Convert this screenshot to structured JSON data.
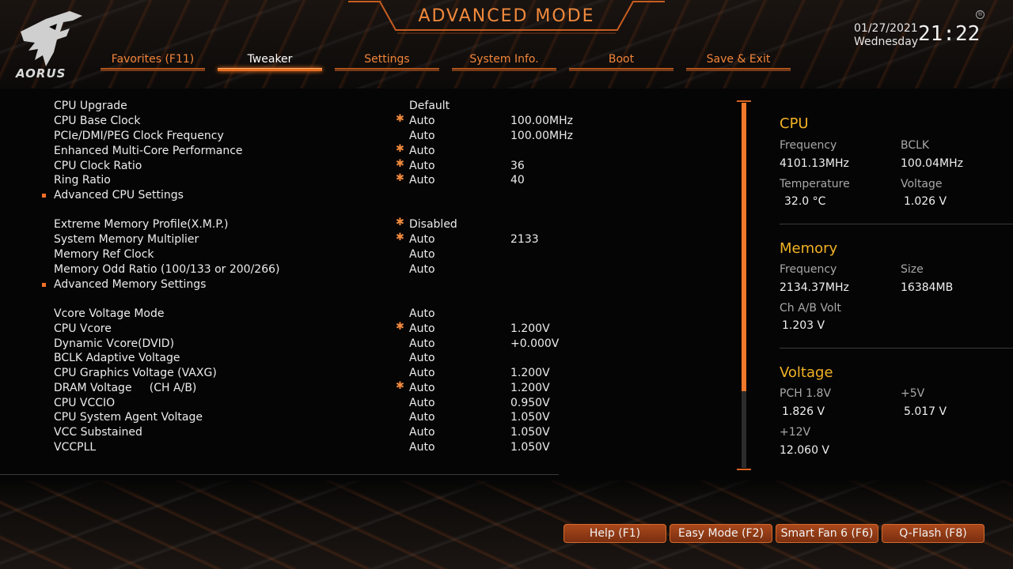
{
  "header": {
    "title": "ADVANCED MODE",
    "brand": "AORUS",
    "date": "01/27/2021",
    "weekday": "Wednesday",
    "time": "21:22"
  },
  "tabs": [
    {
      "label": "Favorites (F11)",
      "active": false
    },
    {
      "label": "Tweaker",
      "active": true
    },
    {
      "label": "Settings",
      "active": false
    },
    {
      "label": "System Info.",
      "active": false
    },
    {
      "label": "Boot",
      "active": false
    },
    {
      "label": "Save & Exit",
      "active": false
    }
  ],
  "settings": [
    {
      "label": "CPU Upgrade",
      "value": "Default",
      "extra": "",
      "star": false,
      "submenu": false
    },
    {
      "label": "CPU Base Clock",
      "value": "Auto",
      "extra": "100.00MHz",
      "star": true,
      "submenu": false
    },
    {
      "label": "PCIe/DMI/PEG Clock Frequency",
      "value": "Auto",
      "extra": "100.00MHz",
      "star": false,
      "submenu": false
    },
    {
      "label": "Enhanced Multi-Core Performance",
      "value": "Auto",
      "extra": "",
      "star": true,
      "submenu": false
    },
    {
      "label": "CPU Clock Ratio",
      "value": "Auto",
      "extra": "36",
      "star": true,
      "submenu": false
    },
    {
      "label": "Ring Ratio",
      "value": "Auto",
      "extra": "40",
      "star": true,
      "submenu": false
    },
    {
      "label": "Advanced CPU Settings",
      "value": "",
      "extra": "",
      "star": false,
      "submenu": true
    },
    {
      "label": "Extreme Memory Profile(X.M.P.)",
      "value": "Disabled",
      "extra": "",
      "star": true,
      "submenu": false
    },
    {
      "label": "System Memory Multiplier",
      "value": "Auto",
      "extra": "2133",
      "star": true,
      "submenu": false
    },
    {
      "label": "Memory Ref Clock",
      "value": "Auto",
      "extra": "",
      "star": false,
      "submenu": false
    },
    {
      "label": "Memory Odd Ratio (100/133 or 200/266)",
      "value": "Auto",
      "extra": "",
      "star": false,
      "submenu": false
    },
    {
      "label": "Advanced Memory Settings",
      "value": "",
      "extra": "",
      "star": false,
      "submenu": true
    },
    {
      "label": "Vcore Voltage Mode",
      "value": "Auto",
      "extra": "",
      "star": false,
      "submenu": false
    },
    {
      "label": "CPU Vcore",
      "value": "Auto",
      "extra": "1.200V",
      "star": true,
      "submenu": false
    },
    {
      "label": "Dynamic Vcore(DVID)",
      "value": "Auto",
      "extra": "+0.000V",
      "star": false,
      "submenu": false
    },
    {
      "label": "BCLK Adaptive Voltage",
      "value": "Auto",
      "extra": "",
      "star": false,
      "submenu": false
    },
    {
      "label": "CPU Graphics Voltage (VAXG)",
      "value": "Auto",
      "extra": "1.200V",
      "star": false,
      "submenu": false
    },
    {
      "label": "DRAM Voltage     (CH A/B)",
      "value": "Auto",
      "extra": "1.200V",
      "star": true,
      "submenu": false
    },
    {
      "label": "CPU VCCIO",
      "value": "Auto",
      "extra": "0.950V",
      "star": false,
      "submenu": false
    },
    {
      "label": "CPU System Agent Voltage",
      "value": "Auto",
      "extra": "1.050V",
      "star": false,
      "submenu": false
    },
    {
      "label": "VCC Substained",
      "value": "Auto",
      "extra": "1.050V",
      "star": false,
      "submenu": false
    },
    {
      "label": "VCCPLL",
      "value": "Auto",
      "extra": "1.050V",
      "star": false,
      "submenu": false
    }
  ],
  "scroll": {
    "visible_fraction": 0.79
  },
  "monitor": {
    "cpu": {
      "title": "CPU",
      "frequency_label": "Frequency",
      "frequency": "4101.13MHz",
      "bclk_label": "BCLK",
      "bclk": "100.04MHz",
      "temperature_label": "Temperature",
      "temperature": "32.0 °C",
      "voltage_label": "Voltage",
      "voltage": "1.026 V"
    },
    "memory": {
      "title": "Memory",
      "frequency_label": "Frequency",
      "frequency": "2134.37MHz",
      "size_label": "Size",
      "size": "16384MB",
      "volt_label": "Ch A/B Volt",
      "volt": "1.203 V"
    },
    "voltage": {
      "title": "Voltage",
      "pch_label": "PCH 1.8V",
      "pch": "1.826 V",
      "v5_label": "+5V",
      "v5": "5.017 V",
      "v12_label": "+12V",
      "v12": "12.060 V"
    }
  },
  "buttons": [
    {
      "label": "Help (F1)"
    },
    {
      "label": "Easy Mode (F2)"
    },
    {
      "label": "Smart Fan 6 (F6)"
    },
    {
      "label": "Q-Flash (F8)"
    }
  ],
  "colors": {
    "accent": "#f2853a",
    "panel_title": "#f2b224",
    "star": "#f28a3c"
  },
  "icons": {
    "logo": "aorus-eagle-logo",
    "star": "star-icon",
    "bullet": "submenu-bullet-icon"
  }
}
